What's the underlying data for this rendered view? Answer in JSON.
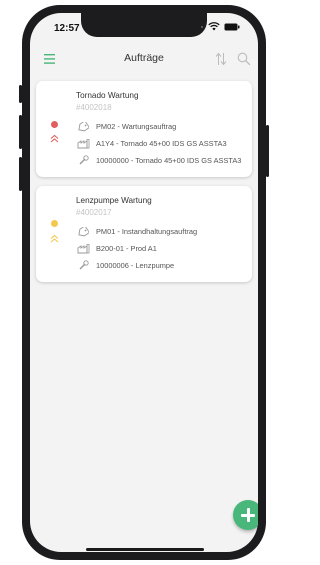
{
  "status_bar": {
    "time": "12:57"
  },
  "nav": {
    "title": "Aufträge"
  },
  "orders": [
    {
      "title": "Tornado Wartung",
      "id": "#4002018",
      "status_color": "#e06060",
      "priority_color": "#e06060",
      "type": "PM02 - Wartungsauftrag",
      "location": "A1Y4 - Tornado 45+00 IDS GS ASSTA3",
      "equipment": "10000000 - Tornado 45+00 IDS GS ASSTA3"
    },
    {
      "title": "Lenzpumpe Wartung",
      "id": "#4002017",
      "status_color": "#f2c94c",
      "priority_color": "#f2c94c",
      "type": "PM01 - Instandhaltungsauftrag",
      "location": "B200-01 - Prod A1",
      "equipment": "10000006 - Lenzpumpe"
    }
  ],
  "colors": {
    "accent": "#49b77a"
  },
  "icons": {
    "menu": "hamburger-icon",
    "sort": "sort-icon",
    "search": "search-icon",
    "add": "plus-icon",
    "type": "tag-icon",
    "location": "factory-icon",
    "equipment": "wrench-icon"
  }
}
